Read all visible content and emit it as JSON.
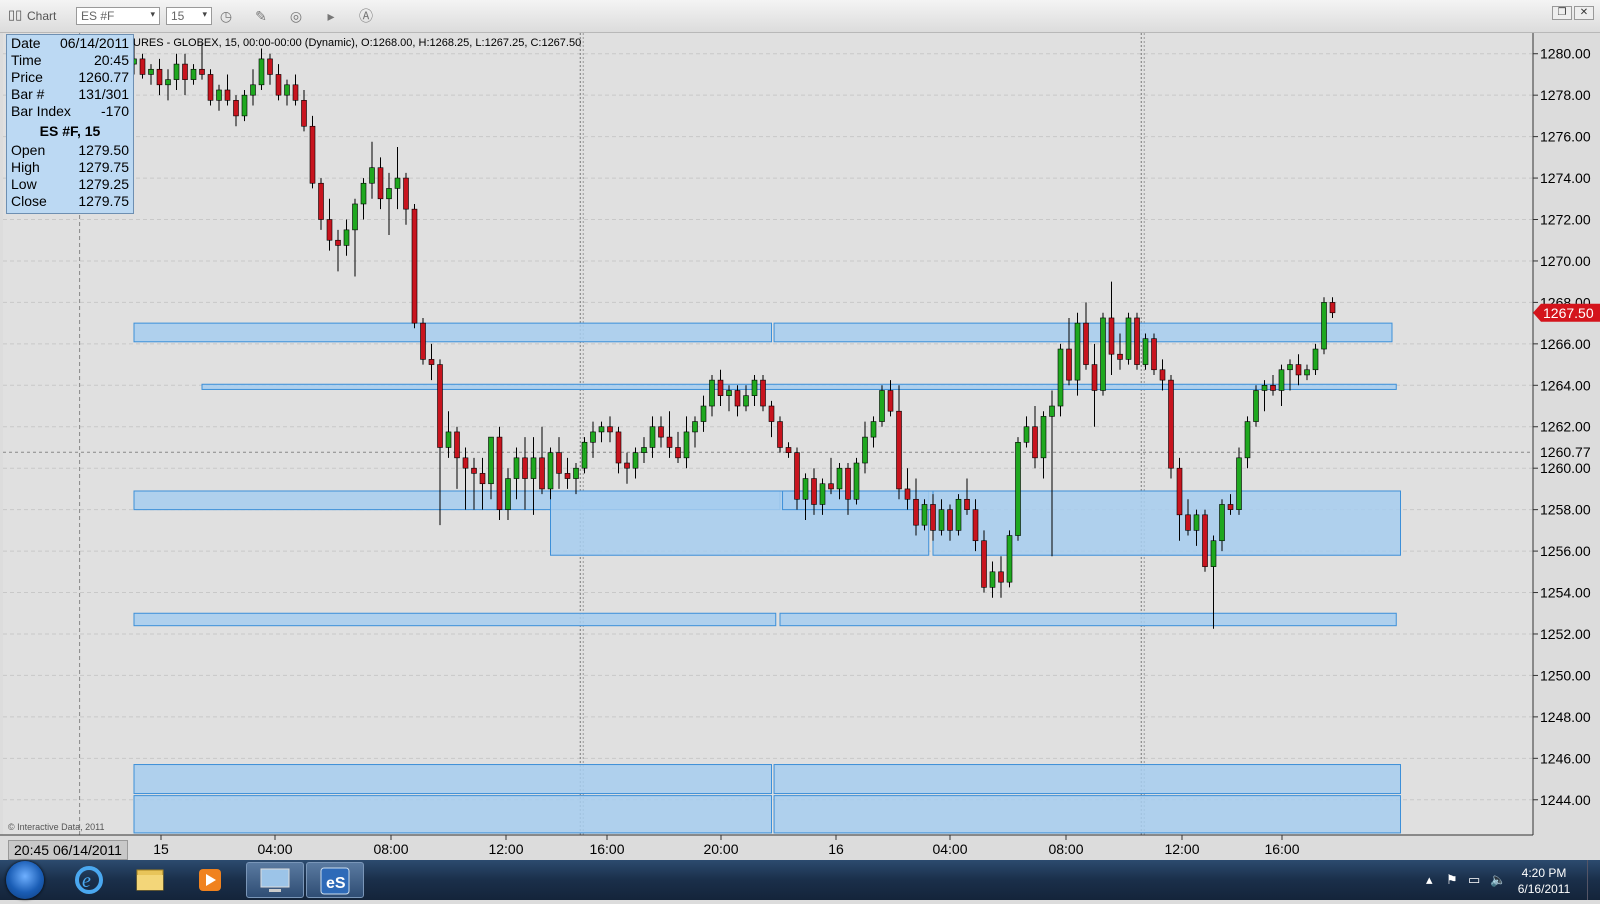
{
  "toolbar": {
    "chart_label": "Chart",
    "symbol_value": "ES #F",
    "interval_value": "15"
  },
  "data_window": {
    "rows_top": [
      {
        "label": "Date",
        "value": "06/14/2011"
      },
      {
        "label": "Time",
        "value": "20:45"
      },
      {
        "label": "Price",
        "value": "1260.77"
      },
      {
        "label": "Bar #",
        "value": "131/301"
      },
      {
        "label": "Bar Index",
        "value": "-170"
      }
    ],
    "title": "ES #F, 15",
    "rows_bottom": [
      {
        "label": "Open",
        "value": "1279.50"
      },
      {
        "label": "High",
        "value": "1279.75"
      },
      {
        "label": "Low",
        "value": "1279.25"
      },
      {
        "label": "Close",
        "value": "1279.75"
      }
    ]
  },
  "info_strip": "URES - GLOBEX, 15, 00:00-00:00 (Dynamic), O:1268.00, H:1268.25, L:1267.25, C:1267.50",
  "copyright": "© Interactive Data, 2011",
  "cursor_datetime": "20:45 06/14/2011",
  "chart_data": {
    "type": "candlestick",
    "symbol": "ES #F",
    "interval": "15",
    "yticks": [
      1280,
      1278,
      1276,
      1274,
      1272,
      1270,
      1268,
      1266,
      1264,
      1262,
      1260,
      1258,
      1256,
      1254,
      1252,
      1250,
      1248,
      1246,
      1244
    ],
    "ylim": [
      1242.3,
      1281.0
    ],
    "xtick_labels": [
      "15",
      "04:00",
      "08:00",
      "12:00",
      "16:00",
      "20:00",
      "16",
      "04:00",
      "08:00",
      "12:00",
      "16:00"
    ],
    "last_price": "1267.50",
    "cursor_price": "1260.77",
    "candles": [
      [
        1279.5,
        1280.5,
        1279.0,
        1279.75
      ],
      [
        1279.75,
        1280.0,
        1278.8,
        1279.0
      ],
      [
        1279.0,
        1279.5,
        1278.5,
        1279.25
      ],
      [
        1279.25,
        1279.75,
        1278.0,
        1278.5
      ],
      [
        1278.5,
        1279.25,
        1277.75,
        1278.75
      ],
      [
        1278.75,
        1280.0,
        1278.25,
        1279.5
      ],
      [
        1279.5,
        1280.0,
        1278.0,
        1278.75
      ],
      [
        1278.75,
        1279.5,
        1278.5,
        1279.25
      ],
      [
        1279.25,
        1280.5,
        1278.75,
        1279.0
      ],
      [
        1279.0,
        1279.25,
        1277.5,
        1277.75
      ],
      [
        1277.75,
        1278.5,
        1277.25,
        1278.25
      ],
      [
        1278.25,
        1279.0,
        1277.5,
        1277.75
      ],
      [
        1277.75,
        1278.0,
        1276.5,
        1277.0
      ],
      [
        1277.0,
        1278.25,
        1276.75,
        1278.0
      ],
      [
        1278.0,
        1279.25,
        1277.5,
        1278.5
      ],
      [
        1278.5,
        1280.25,
        1278.25,
        1279.75
      ],
      [
        1279.75,
        1280.0,
        1278.5,
        1279.0
      ],
      [
        1279.0,
        1279.5,
        1277.75,
        1278.0
      ],
      [
        1278.0,
        1278.75,
        1277.5,
        1278.5
      ],
      [
        1278.5,
        1279.0,
        1277.5,
        1277.75
      ],
      [
        1277.75,
        1278.25,
        1276.25,
        1276.5
      ],
      [
        1276.5,
        1277.0,
        1273.5,
        1273.75
      ],
      [
        1273.75,
        1274.0,
        1271.5,
        1272.0
      ],
      [
        1272.0,
        1273.0,
        1270.5,
        1271.0
      ],
      [
        1271.0,
        1271.5,
        1269.5,
        1270.75
      ],
      [
        1270.75,
        1272.0,
        1270.25,
        1271.5
      ],
      [
        1271.5,
        1273.0,
        1269.25,
        1272.75
      ],
      [
        1272.75,
        1274.0,
        1272.0,
        1273.75
      ],
      [
        1273.75,
        1275.75,
        1273.0,
        1274.5
      ],
      [
        1274.5,
        1275.0,
        1272.5,
        1273.0
      ],
      [
        1273.0,
        1274.25,
        1271.25,
        1273.5
      ],
      [
        1273.5,
        1275.5,
        1272.5,
        1274.0
      ],
      [
        1274.0,
        1274.25,
        1271.75,
        1272.5
      ],
      [
        1272.5,
        1272.75,
        1266.75,
        1267.0
      ],
      [
        1267.0,
        1267.25,
        1265.0,
        1265.25
      ],
      [
        1265.25,
        1266.0,
        1264.25,
        1265.0
      ],
      [
        1265.0,
        1265.25,
        1257.25,
        1261.0
      ],
      [
        1261.0,
        1262.75,
        1260.5,
        1261.75
      ],
      [
        1261.75,
        1262.0,
        1259.0,
        1260.5
      ],
      [
        1260.5,
        1261.0,
        1258.0,
        1260.0
      ],
      [
        1260.0,
        1260.5,
        1258.0,
        1259.75
      ],
      [
        1259.75,
        1260.5,
        1258.0,
        1259.25
      ],
      [
        1259.25,
        1261.5,
        1258.5,
        1261.5
      ],
      [
        1261.5,
        1262.0,
        1257.5,
        1258.0
      ],
      [
        1258.0,
        1260.0,
        1257.5,
        1259.5
      ],
      [
        1259.5,
        1261.0,
        1258.5,
        1260.5
      ],
      [
        1260.5,
        1261.5,
        1258.0,
        1259.5
      ],
      [
        1259.5,
        1261.5,
        1257.75,
        1260.5
      ],
      [
        1260.5,
        1262.0,
        1258.75,
        1259.0
      ],
      [
        1259.0,
        1261.0,
        1258.5,
        1260.75
      ],
      [
        1260.75,
        1261.5,
        1259.0,
        1259.75
      ],
      [
        1259.75,
        1260.5,
        1259.0,
        1259.5
      ],
      [
        1259.5,
        1260.25,
        1258.75,
        1260.0
      ],
      [
        1260.0,
        1261.5,
        1259.75,
        1261.25
      ],
      [
        1261.25,
        1262.25,
        1260.5,
        1261.75
      ],
      [
        1261.75,
        1262.25,
        1261.25,
        1262.0
      ],
      [
        1262.0,
        1262.5,
        1261.25,
        1261.75
      ],
      [
        1261.75,
        1262.0,
        1259.75,
        1260.25
      ],
      [
        1260.25,
        1260.75,
        1259.25,
        1260.0
      ],
      [
        1260.0,
        1261.0,
        1259.5,
        1260.75
      ],
      [
        1260.75,
        1261.5,
        1260.25,
        1261.0
      ],
      [
        1261.0,
        1262.5,
        1260.5,
        1262.0
      ],
      [
        1262.0,
        1262.5,
        1261.0,
        1261.5
      ],
      [
        1261.5,
        1262.75,
        1260.5,
        1261.0
      ],
      [
        1261.0,
        1261.75,
        1260.25,
        1260.5
      ],
      [
        1260.5,
        1262.5,
        1260.0,
        1261.75
      ],
      [
        1261.75,
        1262.5,
        1261.0,
        1262.25
      ],
      [
        1262.25,
        1263.5,
        1261.75,
        1263.0
      ],
      [
        1263.0,
        1264.5,
        1262.5,
        1264.25
      ],
      [
        1264.25,
        1264.75,
        1263.0,
        1263.5
      ],
      [
        1263.5,
        1264.0,
        1262.75,
        1263.75
      ],
      [
        1263.75,
        1264.0,
        1262.5,
        1263.0
      ],
      [
        1263.0,
        1264.0,
        1262.75,
        1263.5
      ],
      [
        1263.5,
        1264.5,
        1263.0,
        1264.25
      ],
      [
        1264.25,
        1264.5,
        1262.75,
        1263.0
      ],
      [
        1263.0,
        1263.25,
        1261.5,
        1262.25
      ],
      [
        1262.25,
        1262.5,
        1260.75,
        1261.0
      ],
      [
        1261.0,
        1261.25,
        1260.5,
        1260.75
      ],
      [
        1260.75,
        1261.0,
        1258.0,
        1258.5
      ],
      [
        1258.5,
        1259.75,
        1257.5,
        1259.5
      ],
      [
        1259.5,
        1260.0,
        1257.75,
        1258.25
      ],
      [
        1258.25,
        1259.5,
        1257.75,
        1259.25
      ],
      [
        1259.25,
        1260.5,
        1258.75,
        1259.0
      ],
      [
        1259.0,
        1260.25,
        1258.5,
        1260.0
      ],
      [
        1260.0,
        1260.25,
        1257.75,
        1258.5
      ],
      [
        1258.5,
        1260.5,
        1258.25,
        1260.25
      ],
      [
        1260.25,
        1262.25,
        1259.75,
        1261.5
      ],
      [
        1261.5,
        1262.5,
        1261.0,
        1262.25
      ],
      [
        1262.25,
        1264.0,
        1262.0,
        1263.75
      ],
      [
        1263.75,
        1264.25,
        1262.5,
        1262.75
      ],
      [
        1262.75,
        1264.0,
        1258.5,
        1259.0
      ],
      [
        1259.0,
        1260.0,
        1258.0,
        1258.5
      ],
      [
        1258.5,
        1259.5,
        1256.75,
        1257.25
      ],
      [
        1257.25,
        1258.5,
        1257.0,
        1258.25
      ],
      [
        1258.25,
        1258.75,
        1256.5,
        1257.0
      ],
      [
        1257.0,
        1258.5,
        1256.75,
        1258.0
      ],
      [
        1258.0,
        1258.25,
        1256.5,
        1257.0
      ],
      [
        1257.0,
        1258.75,
        1256.75,
        1258.5
      ],
      [
        1258.5,
        1259.5,
        1257.75,
        1258.0
      ],
      [
        1258.0,
        1258.5,
        1256.0,
        1256.5
      ],
      [
        1256.5,
        1257.0,
        1254.0,
        1254.25
      ],
      [
        1254.25,
        1255.5,
        1253.75,
        1255.0
      ],
      [
        1255.0,
        1255.75,
        1253.75,
        1254.5
      ],
      [
        1254.5,
        1257.0,
        1254.25,
        1256.75
      ],
      [
        1256.75,
        1261.5,
        1256.5,
        1261.25
      ],
      [
        1261.25,
        1262.5,
        1261.0,
        1262.0
      ],
      [
        1262.0,
        1263.0,
        1260.0,
        1260.5
      ],
      [
        1260.5,
        1262.75,
        1259.5,
        1262.5
      ],
      [
        1262.5,
        1263.75,
        1255.75,
        1263.0
      ],
      [
        1263.0,
        1266.0,
        1262.5,
        1265.75
      ],
      [
        1265.75,
        1267.25,
        1264.0,
        1264.25
      ],
      [
        1264.25,
        1267.5,
        1263.5,
        1267.0
      ],
      [
        1267.0,
        1268.0,
        1264.75,
        1265.0
      ],
      [
        1265.0,
        1266.0,
        1262.0,
        1263.75
      ],
      [
        1263.75,
        1267.5,
        1263.5,
        1267.25
      ],
      [
        1267.25,
        1269.0,
        1264.5,
        1265.5
      ],
      [
        1265.5,
        1266.5,
        1264.75,
        1265.25
      ],
      [
        1265.25,
        1267.5,
        1265.0,
        1267.25
      ],
      [
        1267.25,
        1267.5,
        1264.75,
        1265.0
      ],
      [
        1265.0,
        1266.5,
        1264.75,
        1266.25
      ],
      [
        1266.25,
        1266.5,
        1264.5,
        1264.75
      ],
      [
        1264.75,
        1265.25,
        1263.75,
        1264.25
      ],
      [
        1264.25,
        1264.5,
        1259.5,
        1260.0
      ],
      [
        1260.0,
        1260.5,
        1256.5,
        1257.75
      ],
      [
        1257.75,
        1258.5,
        1256.75,
        1257.0
      ],
      [
        1257.0,
        1258.0,
        1256.25,
        1257.75
      ],
      [
        1257.75,
        1258.0,
        1255.0,
        1255.25
      ],
      [
        1255.25,
        1256.75,
        1252.25,
        1256.5
      ],
      [
        1256.5,
        1258.5,
        1256.0,
        1258.25
      ],
      [
        1258.25,
        1258.75,
        1257.75,
        1258.0
      ],
      [
        1258.0,
        1261.0,
        1257.75,
        1260.5
      ],
      [
        1260.5,
        1262.5,
        1260.0,
        1262.25
      ],
      [
        1262.25,
        1264.0,
        1262.0,
        1263.75
      ],
      [
        1263.75,
        1264.25,
        1262.75,
        1264.0
      ],
      [
        1264.0,
        1264.5,
        1263.5,
        1263.75
      ],
      [
        1263.75,
        1265.0,
        1263.0,
        1264.75
      ],
      [
        1264.75,
        1265.25,
        1263.75,
        1265.0
      ],
      [
        1265.0,
        1265.5,
        1264.0,
        1264.5
      ],
      [
        1264.5,
        1265.0,
        1264.25,
        1264.75
      ],
      [
        1264.75,
        1266.0,
        1264.5,
        1265.75
      ],
      [
        1265.75,
        1268.25,
        1265.5,
        1268.0
      ],
      [
        1268.0,
        1268.25,
        1267.25,
        1267.5
      ]
    ],
    "zones": [
      {
        "x0_bar": 0,
        "x1_bar": 75,
        "top": 1267.0,
        "bottom": 1266.1
      },
      {
        "x0_bar": 75.3,
        "x1_bar": 148,
        "top": 1267.0,
        "bottom": 1266.1
      },
      {
        "x0_bar": 8,
        "x1_bar": 148.5,
        "top": 1264.05,
        "bottom": 1263.8
      },
      {
        "x0_bar": 0,
        "x1_bar": 76,
        "top": 1258.9,
        "bottom": 1258.0
      },
      {
        "x0_bar": 49,
        "x1_bar": 93.5,
        "top": 1258.9,
        "bottom": 1255.8
      },
      {
        "x0_bar": 76.3,
        "x1_bar": 94,
        "top": 1258.9,
        "bottom": 1258.0
      },
      {
        "x0_bar": 94,
        "x1_bar": 149,
        "top": 1258.9,
        "bottom": 1255.8
      },
      {
        "x0_bar": 0,
        "x1_bar": 75.5,
        "top": 1253.0,
        "bottom": 1252.4
      },
      {
        "x0_bar": 76,
        "x1_bar": 148.5,
        "top": 1253.0,
        "bottom": 1252.4
      },
      {
        "x0_bar": 0,
        "x1_bar": 75,
        "top": 1245.7,
        "bottom": 1244.3
      },
      {
        "x0_bar": 75.3,
        "x1_bar": 149,
        "top": 1245.7,
        "bottom": 1244.3
      },
      {
        "x0_bar": 0,
        "x1_bar": 75,
        "top": 1244.2,
        "bottom": 1242.4
      },
      {
        "x0_bar": 75.3,
        "x1_bar": 149,
        "top": 1244.2,
        "bottom": 1242.4
      }
    ],
    "session_lines_bar": [
      52.5,
      118.5
    ],
    "cursor_line_bar": -6.4
  },
  "colors": {
    "up": "#1fa81f",
    "down": "#c8141e",
    "zone_fill": "#a6cdee",
    "zone_stroke": "#3c8fd8",
    "plot_bg": "#e0e0e0",
    "last_price_tag": "#d4141c",
    "data_window_bg": "#bcd9f3"
  },
  "taskbar": {
    "apps": [
      "windows-start-orb",
      "internet-explorer-icon",
      "file-explorer-icon",
      "media-player-icon",
      "network-computer-icon",
      "es-app-icon"
    ],
    "clock_time": "4:20 PM",
    "clock_date": "6/16/2011"
  }
}
